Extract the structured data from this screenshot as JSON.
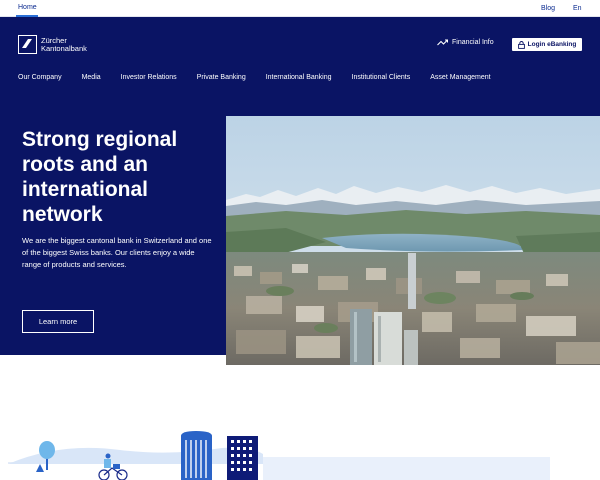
{
  "topbar": {
    "home": "Home",
    "blog": "Blog",
    "lang": "En"
  },
  "header": {
    "logo_line1": "Zürcher",
    "logo_line2": "Kantonalbank",
    "financial_info": "Financial Info",
    "ebanking": "Login eBanking"
  },
  "nav": {
    "items": [
      {
        "label": "Our Company"
      },
      {
        "label": "Media"
      },
      {
        "label": "Investor Relations"
      },
      {
        "label": "Private Banking"
      },
      {
        "label": "International Banking"
      },
      {
        "label": "Institutional Clients"
      },
      {
        "label": "Asset Management"
      }
    ]
  },
  "hero": {
    "title": "Strong regional roots and an international network",
    "body": "We are the biggest cantonal bank in Switzerland and one of the biggest Swiss banks. Our clients enjoy a wide range of products and services.",
    "cta": "Learn more"
  },
  "colors": {
    "navy": "#0a1464",
    "link": "#0a2a8f",
    "accent": "#2a6fd6"
  }
}
